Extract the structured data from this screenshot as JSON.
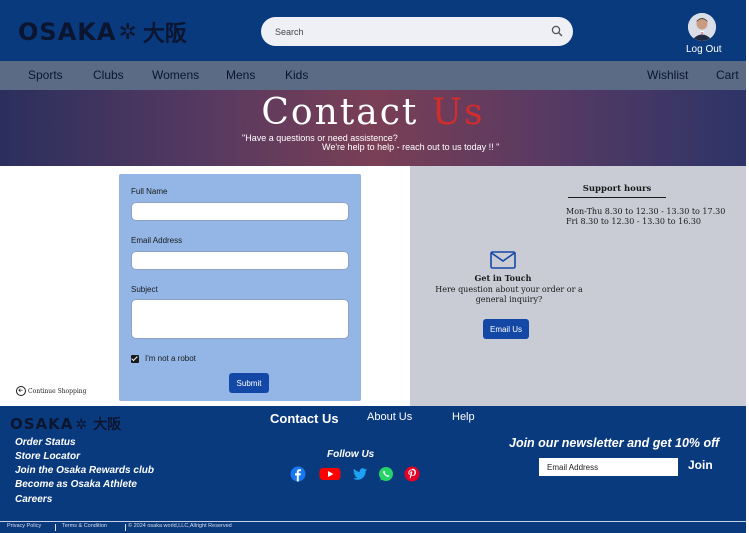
{
  "header": {
    "logo_text": "OSAKA",
    "logo_mark": "✲",
    "logo_kanji": "大阪",
    "search_placeholder": "Search",
    "logout_label": "Log Out"
  },
  "nav": {
    "items": [
      "Sports",
      "Clubs",
      "Womens",
      "Mens",
      "Kids"
    ],
    "wishlist_label": "Wishlist",
    "cart_label": "Cart"
  },
  "hero": {
    "title_white": "Contact ",
    "title_red": "Us",
    "question": "\"Have a questions or need assistence?",
    "subtitle": "We're help to help - reach out to us today !! \""
  },
  "form": {
    "full_name_label": "Full Name",
    "email_label": "Email Address",
    "subject_label": "Subject",
    "robot_label": "I'm not a robot",
    "robot_checked": true,
    "submit_label": "Submit"
  },
  "continue_label": "Continue Shopping",
  "support": {
    "title": "Support hours",
    "hours": [
      "Mon-Thu 8.30 to 12.30 - 13.30 to 17.30",
      "Fri 8.30 to 12.30 - 13.30 to 16.30"
    ],
    "touch_title": "Get in  Touch",
    "touch_text": "Here question about  your order  or a general inquiry?",
    "email_button": "Email Us"
  },
  "footer": {
    "tabs": [
      "Contact Us",
      "About Us",
      "Help"
    ],
    "links": [
      "Order Status",
      "Store Locator",
      "Join the Osaka Rewards club",
      "Become as Osaka Athlete",
      "Careers"
    ],
    "follow_label": "Follow Us",
    "social_icons": [
      "facebook-icon",
      "youtube-icon",
      "twitter-icon",
      "whatsapp-icon",
      "pinterest-icon"
    ],
    "newsletter_text": "Join our newsletter and get 10% off",
    "newsletter_placeholder": "Email Address",
    "join_label": "Join",
    "legal": [
      "Privacy Policy",
      "Terms & Condition",
      "© 2024 osaka world,LLC,Allright Reserved"
    ]
  },
  "colors": {
    "primary_blue": "#0a3a7e",
    "button_blue": "#1348a6",
    "form_blue": "#93b6e6",
    "accent_red": "#d12d2d"
  }
}
